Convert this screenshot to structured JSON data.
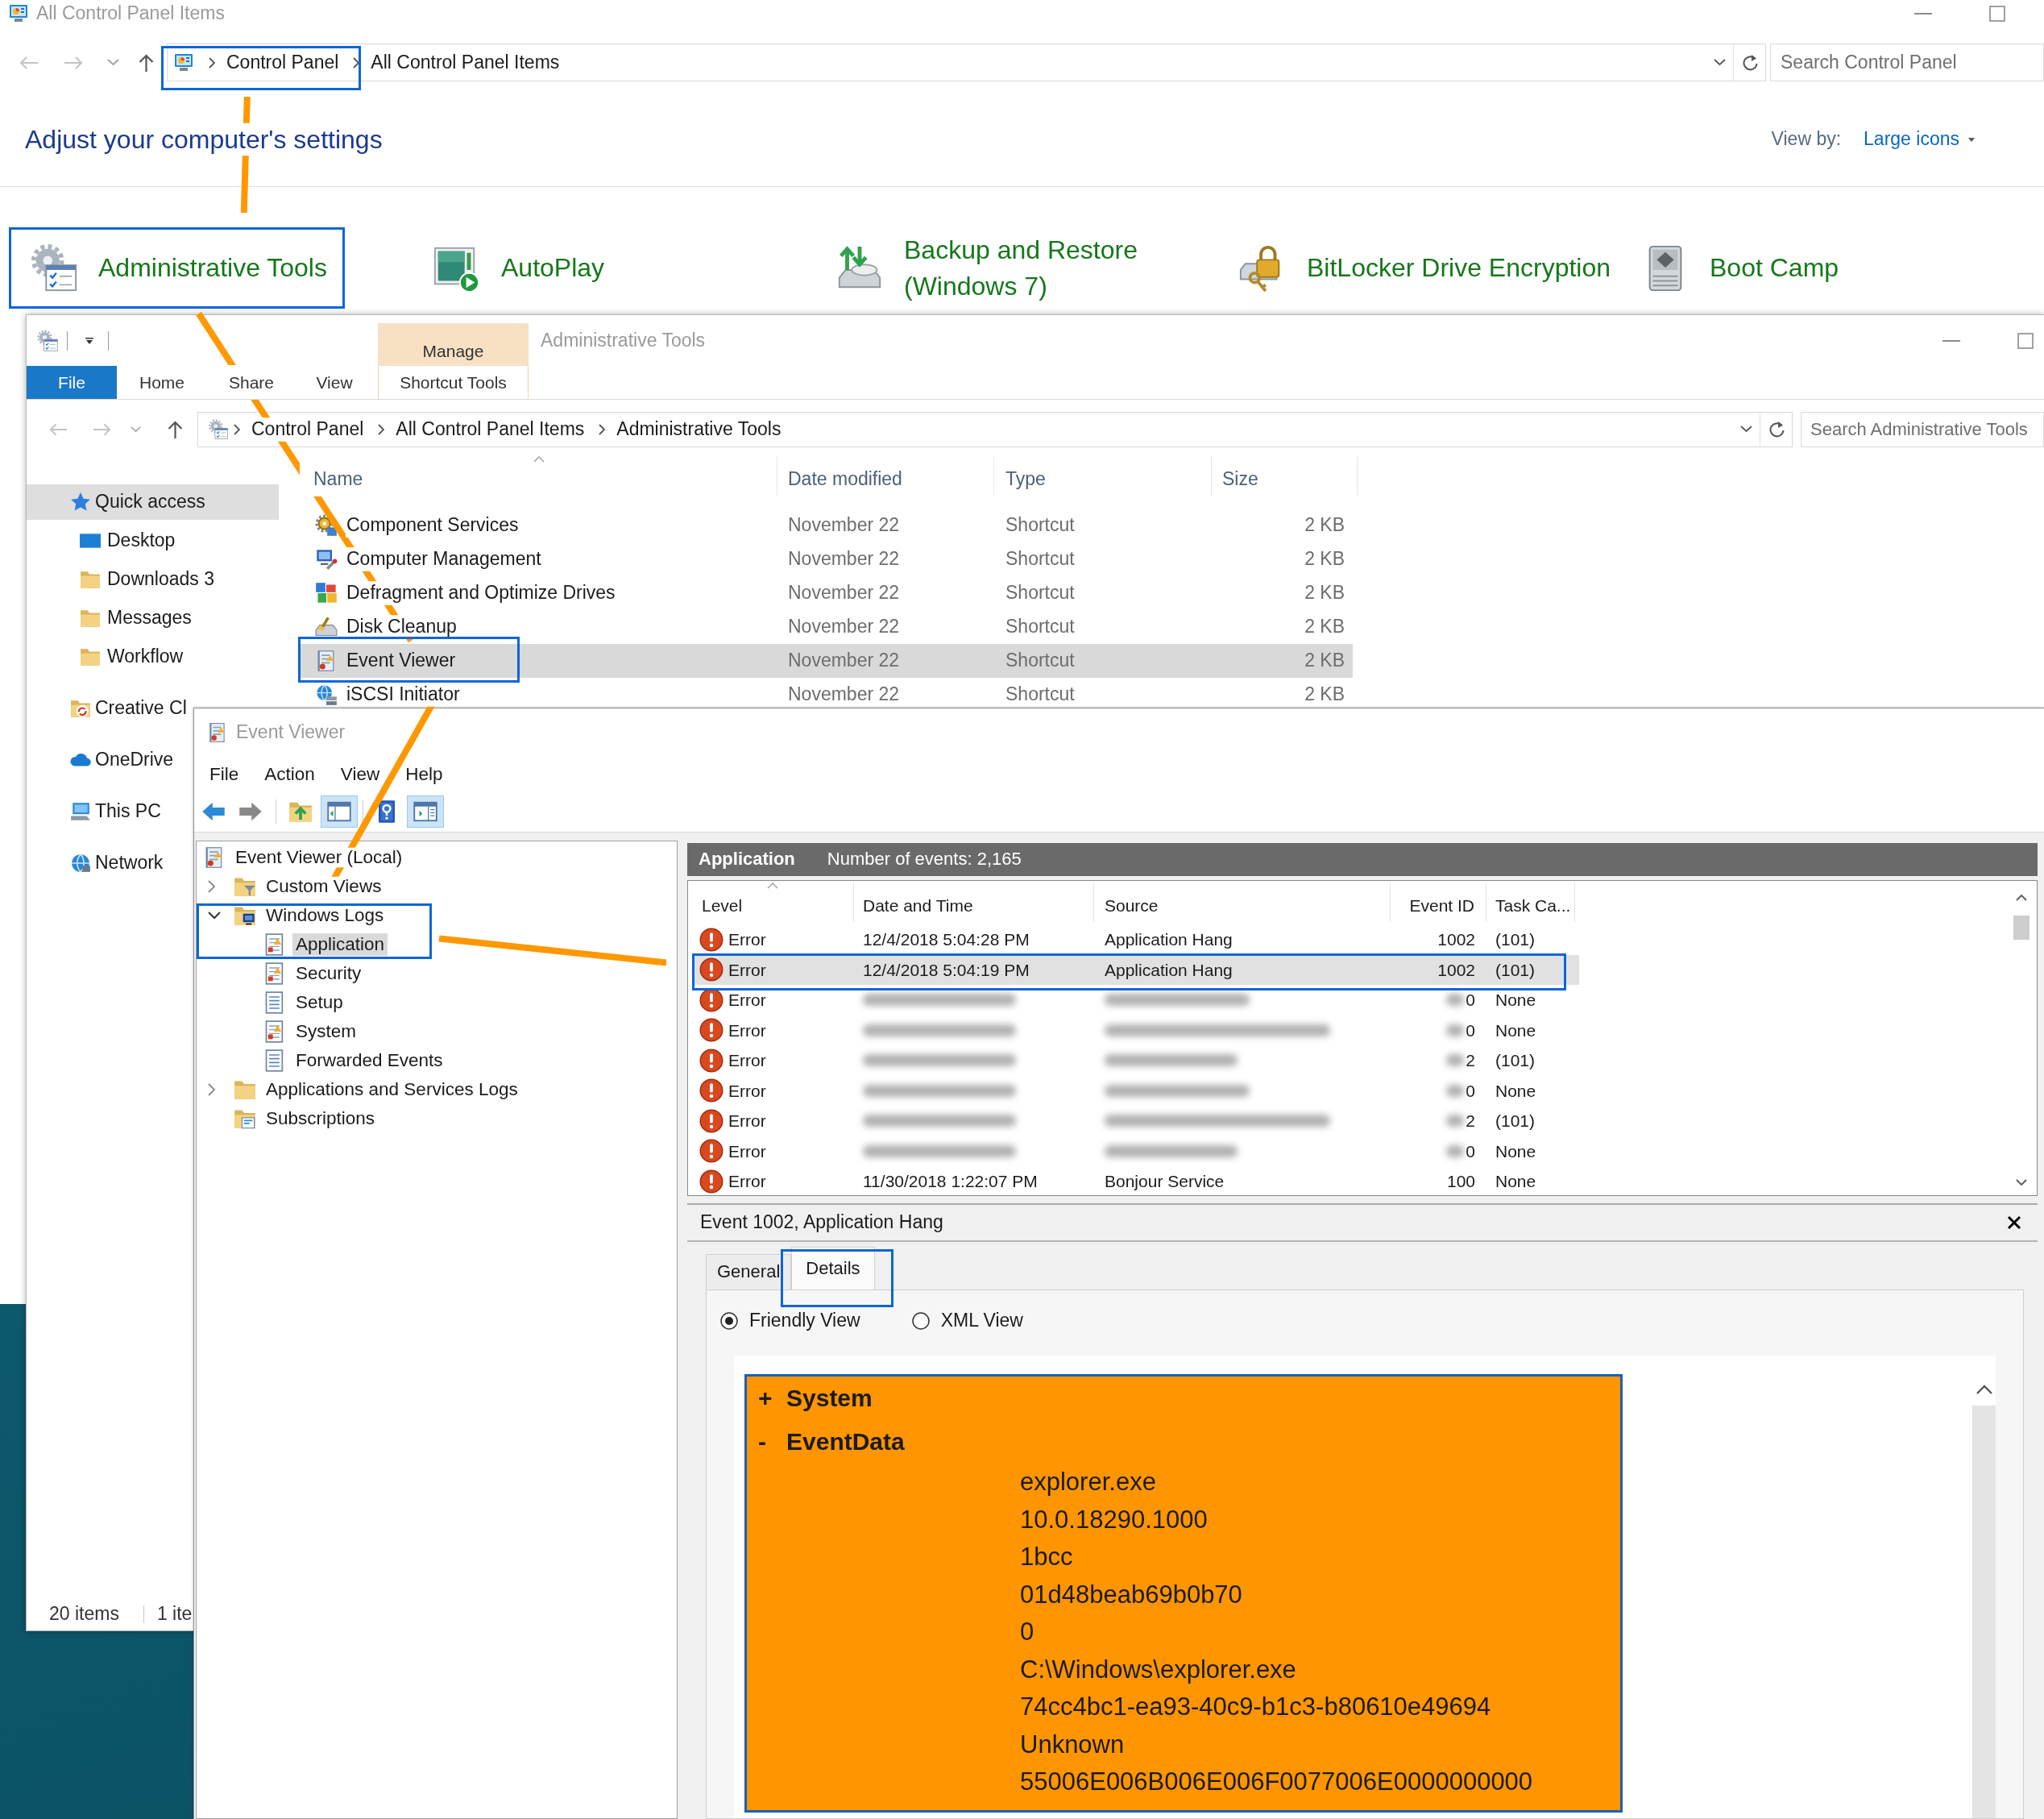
{
  "control_panel": {
    "title": "All Control Panel Items",
    "breadcrumb": [
      {
        "label": "Control Panel",
        "highlighted": true
      },
      {
        "label": "All Control Panel Items",
        "highlighted": false
      }
    ],
    "search": {
      "placeholder": "Search Control Panel"
    },
    "heading": "Adjust your computer's settings",
    "view_by": {
      "label": "View by:",
      "value": "Large icons"
    },
    "items": [
      {
        "label": "Administrative Tools",
        "highlighted": true
      },
      {
        "label": "AutoPlay",
        "highlighted": false
      },
      {
        "label": "Backup and Restore (Windows 7)",
        "highlighted": false
      },
      {
        "label": "BitLocker Drive Encryption",
        "highlighted": false
      },
      {
        "label": "Boot Camp",
        "highlighted": false
      }
    ]
  },
  "explorer": {
    "title": "Administrative Tools",
    "ribbon_tabs": [
      {
        "label": "File",
        "kind": "file"
      },
      {
        "label": "Home",
        "kind": "tab"
      },
      {
        "label": "Share",
        "kind": "tab"
      },
      {
        "label": "View",
        "kind": "tab"
      },
      {
        "label": "Shortcut Tools",
        "kind": "contextual",
        "group": "Manage"
      }
    ],
    "breadcrumb": [
      "Control Panel",
      "All Control Panel Items",
      "Administrative Tools"
    ],
    "search": {
      "placeholder": "Search Administrative Tools"
    },
    "nav": [
      {
        "label": "Quick access",
        "selected": true,
        "children": [
          {
            "label": "Desktop",
            "selected": false
          },
          {
            "label": "Downloads 3",
            "selected": false
          },
          {
            "label": "Messages",
            "selected": false
          },
          {
            "label": "Workflow",
            "selected": false
          }
        ]
      },
      {
        "label": "Creative Cl",
        "selected": false
      },
      {
        "label": "OneDrive",
        "selected": false
      },
      {
        "label": "This PC",
        "selected": false
      },
      {
        "label": "Network",
        "selected": false
      }
    ],
    "columns": [
      {
        "label": "Name",
        "sorted": true
      },
      {
        "label": "Date modified",
        "sorted": false
      },
      {
        "label": "Type",
        "sorted": false
      },
      {
        "label": "Size",
        "sorted": false
      }
    ],
    "files": [
      {
        "name": "Component Services",
        "date": "November 22",
        "type": "Shortcut",
        "size": "2 KB",
        "selected": false,
        "highlighted": false
      },
      {
        "name": "Computer Management",
        "date": "November 22",
        "type": "Shortcut",
        "size": "2 KB",
        "selected": false,
        "highlighted": false
      },
      {
        "name": "Defragment and Optimize Drives",
        "date": "November 22",
        "type": "Shortcut",
        "size": "2 KB",
        "selected": false,
        "highlighted": false
      },
      {
        "name": "Disk Cleanup",
        "date": "November 22",
        "type": "Shortcut",
        "size": "2 KB",
        "selected": false,
        "highlighted": false
      },
      {
        "name": "Event Viewer",
        "date": "November 22",
        "type": "Shortcut",
        "size": "2 KB",
        "selected": true,
        "highlighted": true
      },
      {
        "name": "iSCSI Initiator",
        "date": "November 22",
        "type": "Shortcut",
        "size": "2 KB",
        "selected": false,
        "highlighted": false
      }
    ],
    "status": [
      "20 items",
      "1 ite"
    ]
  },
  "event_viewer": {
    "title": "Event Viewer",
    "menu": [
      "File",
      "Action",
      "View",
      "Help"
    ],
    "toolbar": [
      {
        "pressed": false,
        "disabled": false
      },
      {
        "pressed": false,
        "disabled": true
      },
      {
        "pressed": false,
        "disabled": false
      },
      {
        "pressed": true,
        "disabled": false
      },
      {
        "pressed": false,
        "disabled": false
      },
      {
        "pressed": true,
        "disabled": false
      }
    ],
    "tree": [
      {
        "label": "Event Viewer (Local)",
        "selected": false,
        "highlighted": false,
        "children": [
          {
            "label": "Custom Views",
            "expanded": false,
            "selected": false,
            "highlighted": false
          },
          {
            "label": "Windows Logs",
            "expanded": true,
            "selected": false,
            "highlighted": true,
            "children": [
              {
                "label": "Application",
                "selected": true,
                "highlighted": true
              },
              {
                "label": "Security",
                "selected": false,
                "highlighted": false
              },
              {
                "label": "Setup",
                "selected": false,
                "highlighted": false
              },
              {
                "label": "System",
                "selected": false,
                "highlighted": false
              },
              {
                "label": "Forwarded Events",
                "selected": false,
                "highlighted": false
              }
            ]
          },
          {
            "label": "Applications and Services Logs",
            "expanded": false,
            "selected": false,
            "highlighted": false
          },
          {
            "label": "Subscriptions",
            "selected": false,
            "highlighted": false
          }
        ]
      }
    ],
    "log": {
      "name": "Application",
      "count": "Number of events: 2,165"
    },
    "columns": [
      {
        "label": "Level",
        "sorted": true
      },
      {
        "label": "Date and Time",
        "sorted": false
      },
      {
        "label": "Source",
        "sorted": false
      },
      {
        "label": "Event ID",
        "sorted": false
      },
      {
        "label": "Task Ca...",
        "sorted": false
      }
    ],
    "events": [
      {
        "kind": "error",
        "level": "Error",
        "date": "12/4/2018 5:04:28 PM",
        "source": "Application Hang",
        "event_id": "1002",
        "task": "(101)",
        "selected": false,
        "highlighted": false,
        "blurred": false
      },
      {
        "kind": "error",
        "level": "Error",
        "date": "12/4/2018 5:04:19 PM",
        "source": "Application Hang",
        "event_id": "1002",
        "task": "(101)",
        "selected": true,
        "highlighted": true,
        "blurred": false
      },
      {
        "kind": "error",
        "level": "Error",
        "event_id": "0",
        "task": "None",
        "selected": false,
        "highlighted": false,
        "blurred": true
      },
      {
        "kind": "error",
        "level": "Error",
        "event_id": "0",
        "task": "None",
        "selected": false,
        "highlighted": false,
        "blurred": true
      },
      {
        "kind": "error",
        "level": "Error",
        "event_id": "2",
        "task": "(101)",
        "selected": false,
        "highlighted": false,
        "blurred": true
      },
      {
        "kind": "error",
        "level": "Error",
        "event_id": "0",
        "task": "None",
        "selected": false,
        "highlighted": false,
        "blurred": true
      },
      {
        "kind": "error",
        "level": "Error",
        "event_id": "2",
        "task": "(101)",
        "selected": false,
        "highlighted": false,
        "blurred": true
      },
      {
        "kind": "error",
        "level": "Error",
        "event_id": "0",
        "task": "None",
        "selected": false,
        "highlighted": false,
        "blurred": true
      },
      {
        "kind": "error",
        "level": "Error",
        "date": "11/30/2018 1:22:07 PM",
        "source": "Bonjour Service",
        "event_id": "100",
        "task": "None",
        "selected": false,
        "highlighted": false,
        "blurred": false
      }
    ],
    "detail": {
      "title": "Event 1002, Application Hang",
      "tabs": [
        {
          "label": "General",
          "selected": false,
          "highlighted": false
        },
        {
          "label": "Details",
          "selected": true,
          "highlighted": true
        }
      ],
      "views": [
        {
          "label": "Friendly View",
          "selected": true
        },
        {
          "label": "XML View",
          "selected": false
        }
      ],
      "highlighted": true,
      "sections": [
        {
          "toggle": "+",
          "label": "System"
        },
        {
          "toggle": "-",
          "label": "EventData",
          "values": [
            "explorer.exe",
            "10.0.18290.1000",
            "1bcc",
            "01d48beab69b0b70",
            "0",
            "C:\\Windows\\explorer.exe",
            "74cc4bc1-ea93-40c9-b1c3-b80610e49694",
            "Unknown",
            "55006E006B006E006F0077006E0000000000"
          ]
        }
      ]
    }
  }
}
